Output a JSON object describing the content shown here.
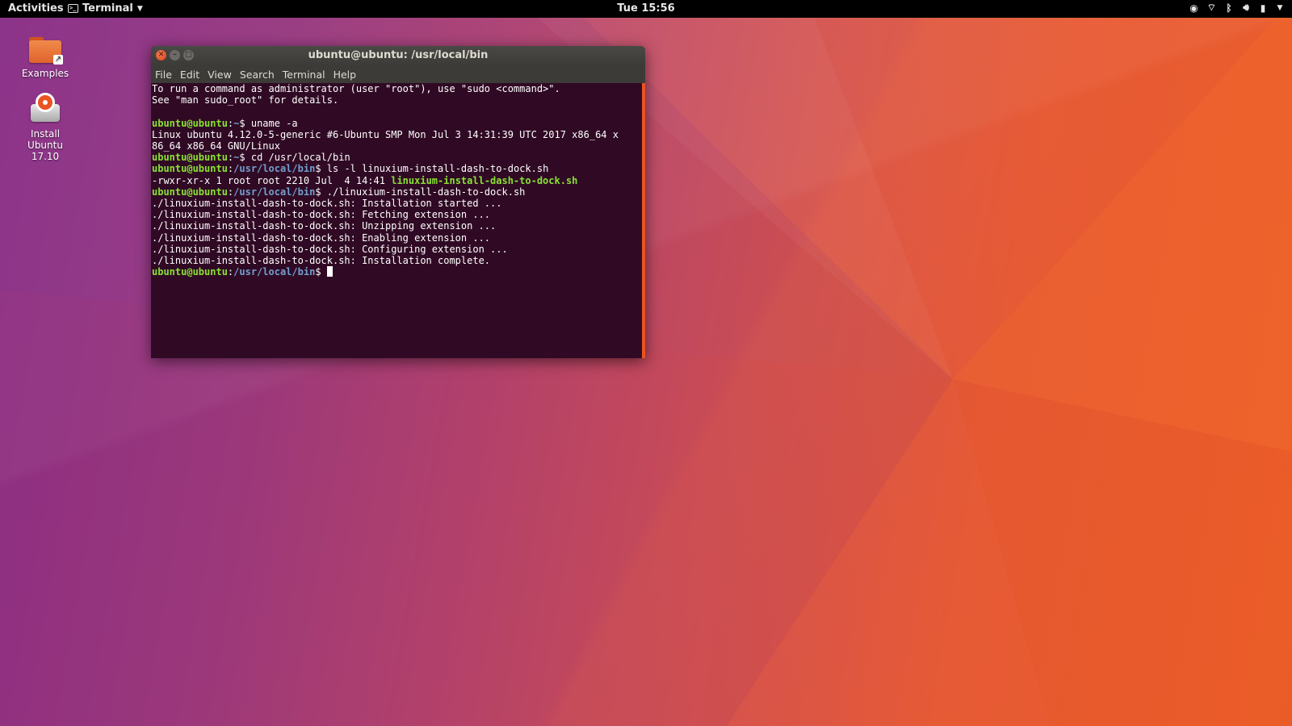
{
  "topbar": {
    "activities": "Activities",
    "app_name": "Terminal",
    "clock": "Tue 15:56",
    "tray_icons": [
      "accessibility-icon",
      "wifi-icon",
      "bluetooth-icon",
      "volume-icon",
      "battery-icon",
      "system-menu-caret-icon"
    ]
  },
  "desktop": {
    "examples_label": "Examples",
    "install_label_1": "Install",
    "install_label_2": "Ubuntu",
    "install_label_3": "17.10"
  },
  "window": {
    "title": "ubuntu@ubuntu: /usr/local/bin",
    "menu": [
      "File",
      "Edit",
      "View",
      "Search",
      "Terminal",
      "Help"
    ]
  },
  "terminal": {
    "line1": "To run a command as administrator (user \"root\"), use \"sudo <command>\".",
    "line2": "See \"man sudo_root\" for details.",
    "user_host": "ubuntu@ubuntu",
    "home": "~",
    "cwd": "/usr/local/bin",
    "cmd_uname": "uname -a",
    "uname_out1": "Linux ubuntu 4.12.0-5-generic #6-Ubuntu SMP Mon Jul 3 14:31:39 UTC 2017 x86_64 x",
    "uname_out2": "86_64 x86_64 GNU/Linux",
    "cmd_cd": "cd /usr/local/bin",
    "cmd_ls": "ls -l linuxium-install-dash-to-dock.sh",
    "ls_meta": "-rwxr-xr-x 1 root root 2210 Jul  4 14:41 ",
    "ls_file": "linuxium-install-dash-to-dock.sh",
    "cmd_run": "./linuxium-install-dash-to-dock.sh",
    "out": [
      "./linuxium-install-dash-to-dock.sh: Installation started ...",
      "./linuxium-install-dash-to-dock.sh: Fetching extension ...",
      "./linuxium-install-dash-to-dock.sh: Unzipping extension ...",
      "./linuxium-install-dash-to-dock.sh: Enabling extension ...",
      "./linuxium-install-dash-to-dock.sh: Configuring extension ...",
      "./linuxium-install-dash-to-dock.sh: Installation complete."
    ]
  },
  "colors": {
    "terminal_bg": "#300a24",
    "prompt_user": "#8ae234",
    "prompt_path": "#729fcf",
    "accent": "#e95420"
  }
}
